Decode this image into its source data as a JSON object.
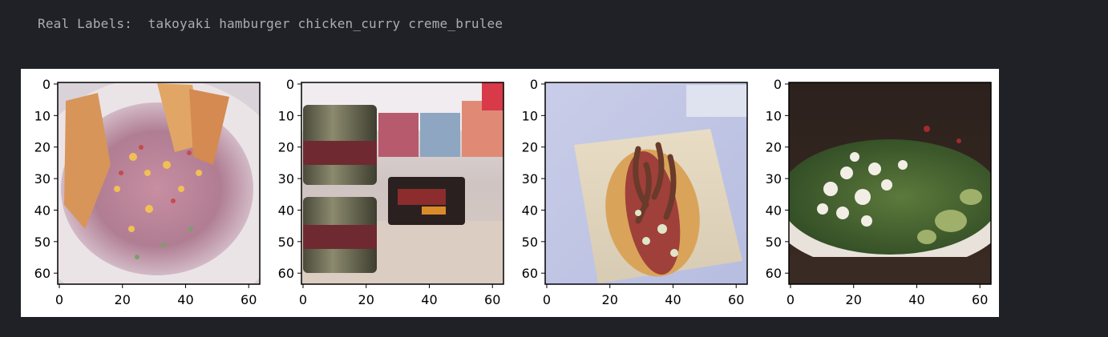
{
  "output": {
    "label_prefix": "Real Labels:",
    "labels": [
      "takoyaki",
      "hamburger",
      "chicken_curry",
      "creme_brulee"
    ]
  },
  "figure": {
    "panel_count": 4,
    "images": [
      {
        "subject": "ceviche-with-sweet-potato"
      },
      {
        "subject": "cans-and-tins"
      },
      {
        "subject": "hot-dog-with-onions"
      },
      {
        "subject": "greek-salad-with-feta"
      }
    ],
    "axes": {
      "x_ticks": [
        "0",
        "20",
        "40",
        "60"
      ],
      "y_ticks": [
        "0",
        "10",
        "20",
        "30",
        "40",
        "50",
        "60"
      ],
      "xlim": [
        -0.5,
        63.5
      ],
      "ylim": [
        63.5,
        -0.5
      ]
    }
  }
}
